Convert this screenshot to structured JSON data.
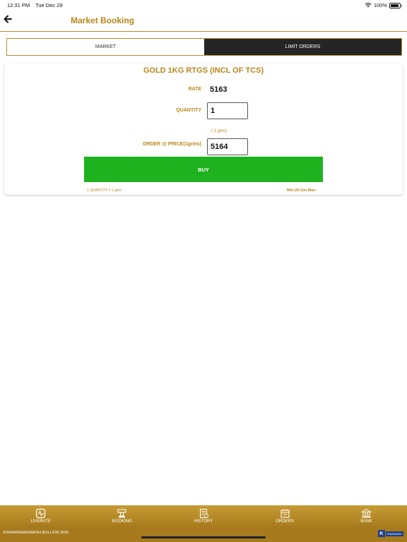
{
  "status_bar": {
    "time": "12:31 PM",
    "date": "Tue Dec 29",
    "battery": "100%"
  },
  "nav": {
    "title": "Market Booking"
  },
  "tabs": [
    {
      "label": "MARKET",
      "active": false
    },
    {
      "label": "LIMIT ORDERS",
      "active": true
    }
  ],
  "card": {
    "product_title": "GOLD 1KG RTGS (INCL OF TCS)",
    "rate_label": "RATE",
    "rate_value": "5163",
    "quantity_label": "QUANTITY",
    "quantity_value": "1",
    "grams_note": "( 1 gms)",
    "price_label": "ORDER @ PRICE(1grms)",
    "price_value": "5164",
    "buy_label": "BUY",
    "footnote_left": "1 QUANTITY = 1 gms",
    "footnote_right": "Min:20 Gm Max:"
  },
  "bottom_tabs": [
    {
      "label": "LIVERATE",
      "icon": "liverate-icon"
    },
    {
      "label": "BOOKING",
      "icon": "booking-icon"
    },
    {
      "label": "HISTORY",
      "icon": "history-icon"
    },
    {
      "label": "ORDERS",
      "icon": "orders-icon"
    },
    {
      "label": "BANK",
      "icon": "bank-icon"
    }
  ],
  "footer": {
    "copyright": "©SWARNAAKAARSH BULLION 2020",
    "brand_letter": "K",
    "brand_text": "KINDMARK"
  },
  "colors": {
    "accent": "#b7861a",
    "buy": "#1fb21f",
    "active_tab": "#252525",
    "tab_bar": "#b68a27"
  }
}
